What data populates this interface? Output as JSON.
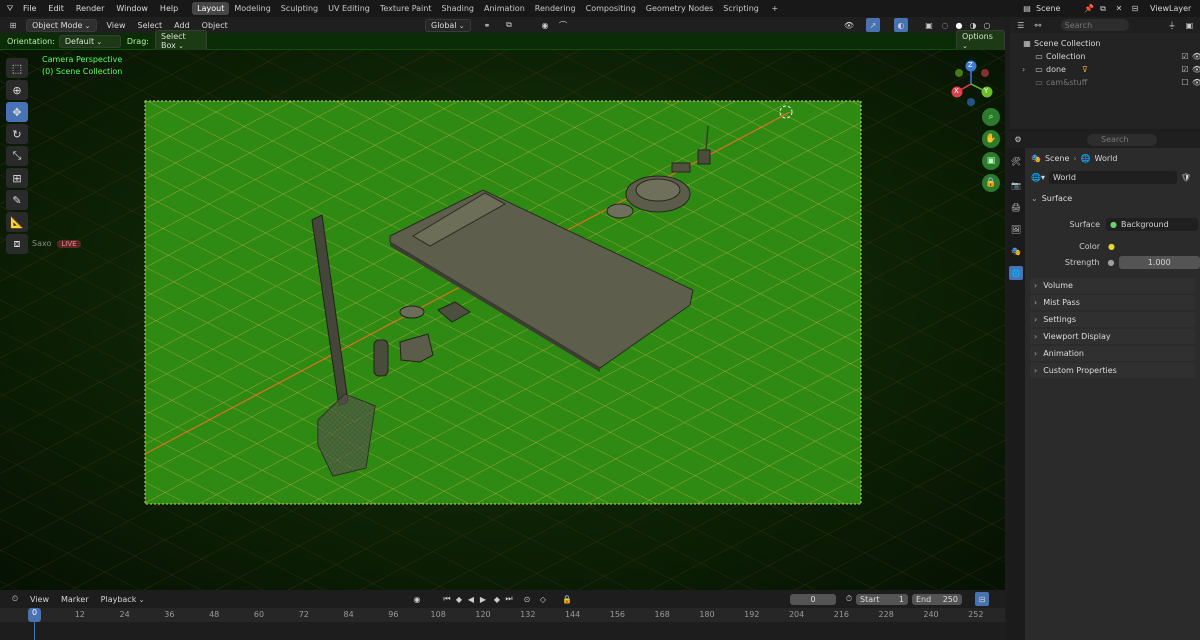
{
  "topbar": {
    "menus": [
      "File",
      "Edit",
      "Render",
      "Window",
      "Help"
    ],
    "workspaces": [
      "Layout",
      "Modeling",
      "Sculpting",
      "UV Editing",
      "Texture Paint",
      "Shading",
      "Animation",
      "Rendering",
      "Compositing",
      "Geometry Nodes",
      "Scripting"
    ],
    "active_workspace": "Layout",
    "scene": "Scene",
    "view_layer": "ViewLayer"
  },
  "viewport_header": {
    "mode": "Object Mode",
    "menus": [
      "View",
      "Select",
      "Add",
      "Object"
    ],
    "transform_orientation": "Global"
  },
  "tool_settings": {
    "orientation_label": "Orientation:",
    "orientation_value": "Default",
    "drag_label": "Drag:",
    "drag_value": "Select Box",
    "options": "Options"
  },
  "viewport": {
    "camera_label": "Camera Perspective",
    "collection_label": "(0) Scene Collection",
    "overlay_user": "Saxo",
    "live_badge": "LIVE",
    "axis_x": "X",
    "axis_y": "Y",
    "axis_z": "Z"
  },
  "outliner": {
    "search_placeholder": "Search",
    "root": "Scene Collection",
    "items": [
      {
        "name": "Collection"
      },
      {
        "name": "done"
      },
      {
        "name": "cam&stuff"
      }
    ]
  },
  "properties": {
    "search_placeholder": "Search",
    "breadcrumb_scene": "Scene",
    "breadcrumb_world": "World",
    "world_name": "World",
    "surface_section": "Surface",
    "surface_label": "Surface",
    "surface_value": "Background",
    "color_label": "Color",
    "strength_label": "Strength",
    "strength_value": "1.000",
    "panels": [
      "Volume",
      "Mist Pass",
      "Settings",
      "Viewport Display",
      "Animation",
      "Custom Properties"
    ]
  },
  "timeline": {
    "menus": [
      "View",
      "Marker",
      "Playback"
    ],
    "current_frame": "0",
    "start_label": "Start",
    "start_value": "1",
    "end_label": "End",
    "end_value": "250",
    "ticks": [
      "0",
      "12",
      "24",
      "36",
      "48",
      "60",
      "72",
      "84",
      "96",
      "108",
      "120",
      "132",
      "144",
      "156",
      "168",
      "180",
      "192",
      "204",
      "216",
      "228",
      "240",
      "252"
    ]
  },
  "colors": {
    "accent": "#4772b3",
    "viewport_green": "#2e8a12",
    "grid_orange": "#d6b04a",
    "live_red": "#b33a3a"
  }
}
